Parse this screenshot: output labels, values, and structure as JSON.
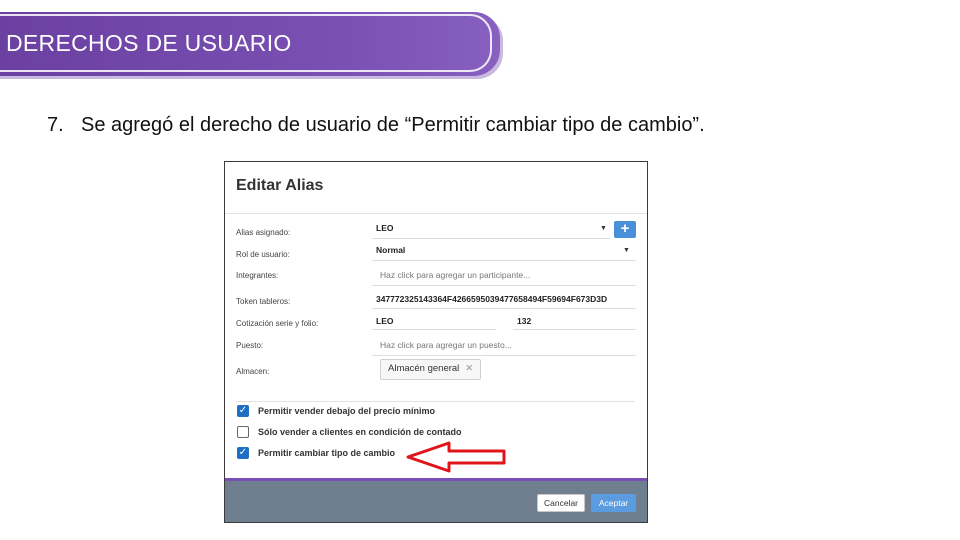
{
  "slide": {
    "title": "DERECHOS DE USUARIO",
    "point_number": "7.",
    "point_text": "Se agregó el derecho de usuario de “Permitir cambiar tipo de cambio”."
  },
  "dialog": {
    "title": "Editar Alias",
    "fields": {
      "alias_label": "Alias asignado:",
      "alias_value": "LEO",
      "rol_label": "Rol de usuario:",
      "rol_value": "Normal",
      "integrantes_label": "Integrantes:",
      "integrantes_placeholder": "Haz click para agregar un participante...",
      "token_label": "Token tableros:",
      "token_value": "347772325143364F4266595039477658494F59694F673D3D",
      "cotizacion_label": "Cotización serie y folio:",
      "cotizacion_serie": "LEO",
      "cotizacion_folio": "132",
      "puesto_label": "Puesto:",
      "puesto_placeholder": "Haz click para agregar un puesto...",
      "almacen_label": "Almacen:",
      "almacen_tag": "Almacén general",
      "tag_remove": "✕"
    },
    "plus_label": "+",
    "checkboxes": [
      {
        "label": "Permitir vender debajo del precio mínimo",
        "checked": true
      },
      {
        "label": "Sólo vender a clientes en condición de contado",
        "checked": false
      },
      {
        "label": "Permitir cambiar tipo de cambio",
        "checked": true
      }
    ],
    "buttons": {
      "cancel": "Cancelar",
      "accept": "Aceptar"
    }
  },
  "colors": {
    "banner": "#6a3fa0",
    "annotation_arrow": "#e0141b",
    "accept_button": "#5b9be0",
    "footer": "#6f7f8f"
  }
}
